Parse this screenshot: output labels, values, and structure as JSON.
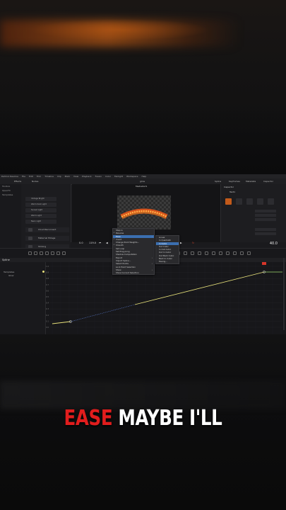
{
  "app": {
    "title": "glow",
    "menu": [
      "DaVinci Resolve",
      "File",
      "Edit",
      "Trim",
      "Timeline",
      "Clip",
      "Mark",
      "View",
      "Playback",
      "Fusion",
      "Color",
      "Fairlight",
      "Workspace",
      "Help"
    ],
    "toolbar": {
      "effects": "Effects",
      "nodes": "Nodes",
      "spline": "Spline",
      "keyframes": "Keyframes",
      "metadata": "Metadata",
      "inspector": "Inspector"
    },
    "viewer_label": "MediaOut1",
    "inspector_title": "Inspector",
    "inspector_node": "Text1"
  },
  "effects": {
    "sidebar": [
      "Toolbox",
      "OpenFX",
      "Templates"
    ],
    "items": [
      "Vintage Bright",
      "Warm Dark Light",
      "Sunset Light",
      "Warm Light",
      "Neon Light"
    ],
    "big_items": [
      "Cloud Reconnect",
      "Maternal Mirage",
      "Shining"
    ]
  },
  "transport": {
    "frame_start": "0.0",
    "frame_end": "119.0",
    "timecode": "40.0"
  },
  "spline": {
    "title": "Spline",
    "tree": [
      "Templates",
      "Glow"
    ],
    "y_ticks": [
      "1.0",
      "0.9",
      "0.8",
      "0.7",
      "0.6",
      "0.5",
      "0.4",
      "0.3",
      "0.2",
      "0.1",
      "0.0"
    ]
  },
  "context_menu": {
    "items": [
      "Step In",
      "Reverse",
      "Ease",
      "Invert",
      "Change Point Weights...",
      "Smooth",
      "Set Loop",
      "Set Ping-pong",
      "Shadow Computation",
      "Export",
      "Import Spline...",
      "Select Points",
      "Lock Point Selection",
      "Show",
      "Show Current Selection"
    ],
    "highlighted": "Ease"
  },
  "ease_submenu": {
    "items": [
      "Linear",
      "In Quadratic",
      "In Cubic",
      "Out Cubic",
      "In Out Cubic",
      "Out In Cubic",
      "Out Back Cubic",
      "Back In Cubic",
      "Easing..."
    ],
    "highlighted": "In Cubic"
  },
  "caption": {
    "red": "EASE",
    "white": "MAYBE I'LL"
  },
  "colors": {
    "accent": "#c35a1a",
    "caption_red": "#e11d1d",
    "caption_white": "#ffffff",
    "curve": "#e6e07a",
    "highlight": "#3b6fb0"
  }
}
